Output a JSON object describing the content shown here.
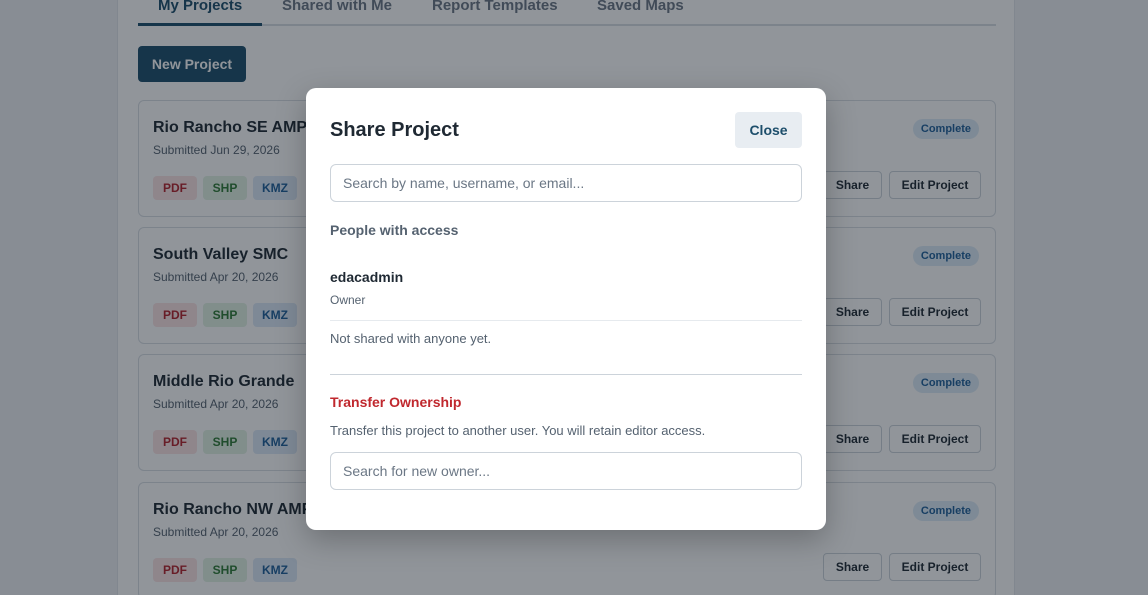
{
  "tabs": [
    {
      "label": "My Projects",
      "active": true
    },
    {
      "label": "Shared with Me",
      "active": false
    },
    {
      "label": "Report Templates",
      "active": false
    },
    {
      "label": "Saved Maps",
      "active": false
    }
  ],
  "toolbar": {
    "new_project_label": "New Project"
  },
  "projects": [
    {
      "name": "Rio Rancho SE AMP",
      "date": "Submitted Jun 29, 2026",
      "status": "Complete",
      "formats": [
        "PDF",
        "SHP",
        "KMZ"
      ],
      "share_label": "Share",
      "edit_label": "Edit Project"
    },
    {
      "name": "South Valley SMC",
      "date": "Submitted Apr 20, 2026",
      "status": "Complete",
      "formats": [
        "PDF",
        "SHP",
        "KMZ"
      ],
      "share_label": "Share",
      "edit_label": "Edit Project"
    },
    {
      "name": "Middle Rio Grande",
      "date": "Submitted Apr 20, 2026",
      "status": "Complete",
      "formats": [
        "PDF",
        "SHP",
        "KMZ"
      ],
      "share_label": "Share",
      "edit_label": "Edit Project"
    },
    {
      "name": "Rio Rancho NW AMP",
      "date": "Submitted Apr 20, 2026",
      "status": "Complete",
      "formats": [
        "PDF",
        "SHP",
        "KMZ"
      ],
      "share_label": "Share",
      "edit_label": "Edit Project"
    }
  ],
  "modal": {
    "title": "Share Project",
    "close_label": "Close",
    "search_placeholder": "Search by name, username, or email...",
    "access_label": "People with access",
    "people": [
      {
        "name": "edacadmin",
        "role": "Owner"
      }
    ],
    "empty_text": "Not shared with anyone yet.",
    "transfer_title": "Transfer Ownership",
    "transfer_desc": "Transfer this project to another user. You will retain editor access.",
    "owner_placeholder": "Search for new owner..."
  },
  "colors": {
    "primary": "#1d4e6b",
    "danger": "#c0282e",
    "badge_bg": "#dcebf8",
    "badge_text": "#1e5f99"
  }
}
